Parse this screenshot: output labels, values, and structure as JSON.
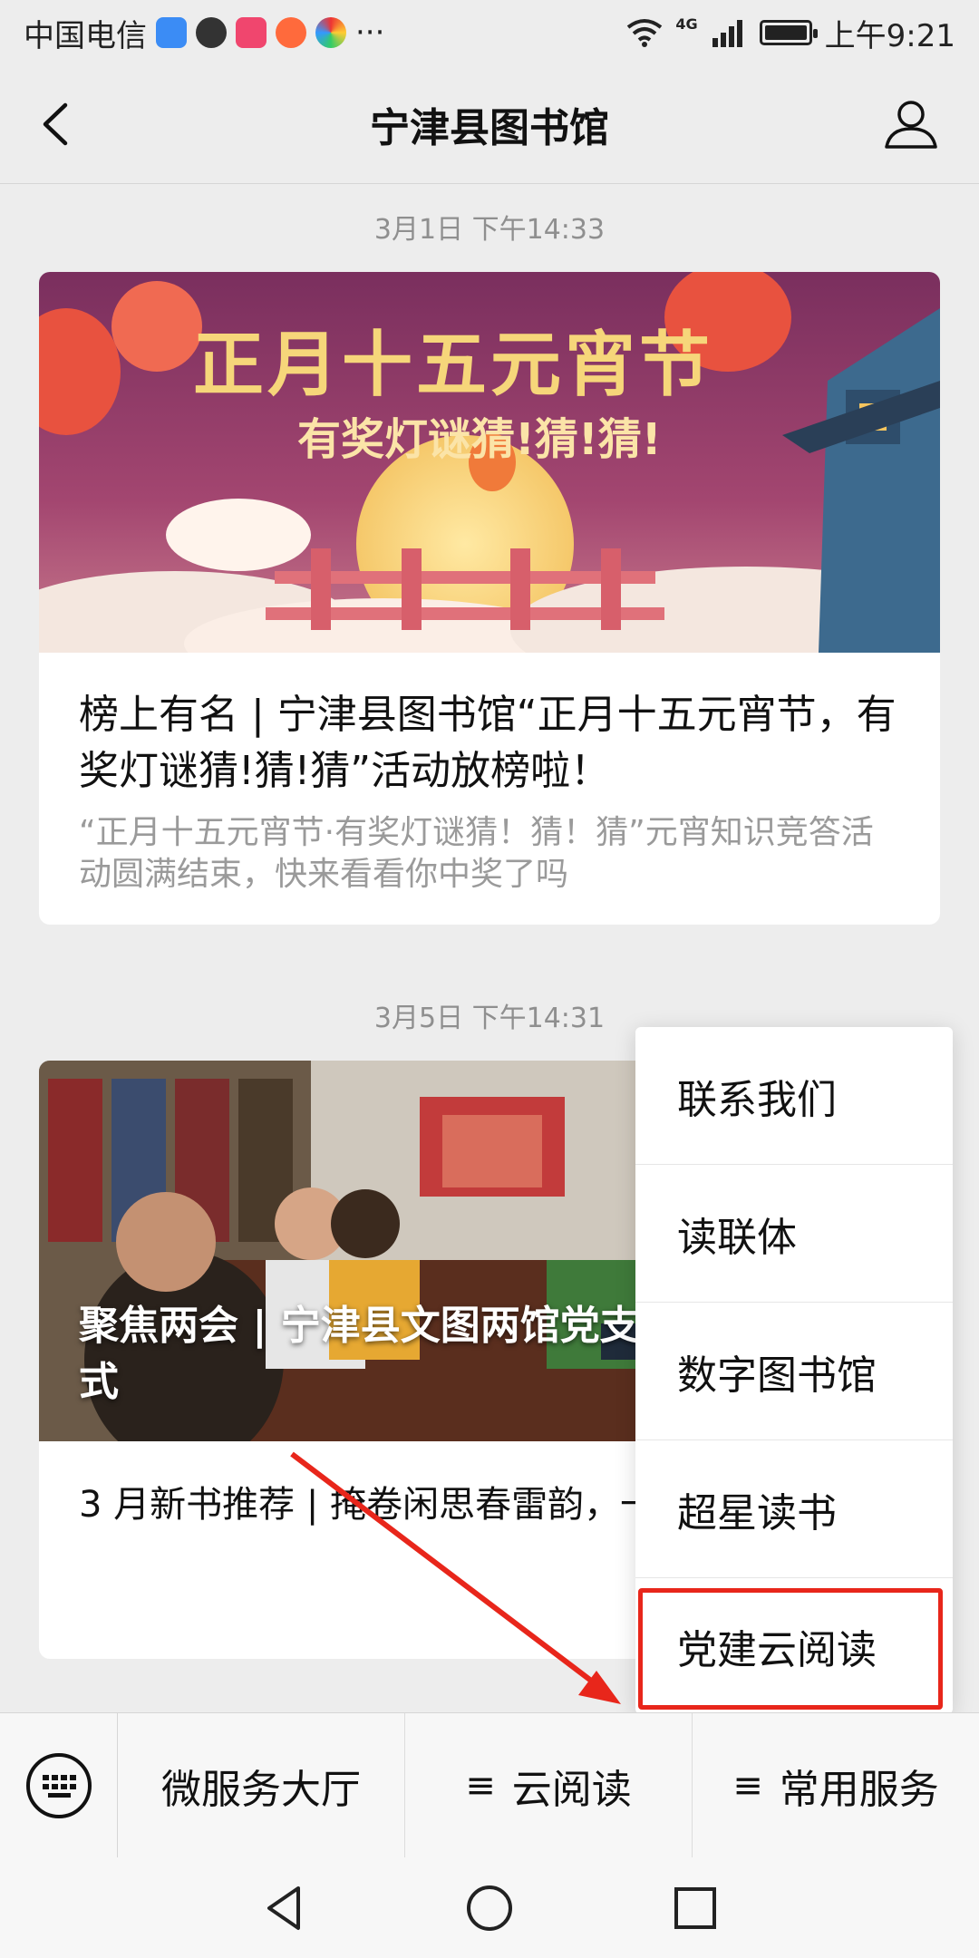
{
  "status_bar": {
    "carrier": "中国电信",
    "more": "···",
    "network": "4G",
    "time": "上午9:21"
  },
  "nav": {
    "title": "宁津县图书馆"
  },
  "messages": [
    {
      "timestamp": "3月1日 下午14:33",
      "banner": {
        "headline": "正月十五元宵节",
        "subline": "有奖灯谜猜!猜!猜!"
      },
      "title": "榜上有名 | 宁津县图书馆“正月十五元宵节，有奖灯谜猜!猜!猜”活动放榜啦！",
      "desc": "“正月十五元宵节·有奖灯谜猜！猜！猜”元宵知识竞答活动圆满结束，快来看看你中奖了吗"
    },
    {
      "timestamp": "3月5日 下午14:31",
      "caption": "聚焦两会 | 宁津县文图两馆党支部收看两会开幕式",
      "sub_title": "3 月新书推荐 | 掩卷闲思春雷韵，一抹新绿迎惊蛰"
    }
  ],
  "popup_menu": {
    "items": [
      "联系我们",
      "读联体",
      "数字图书馆",
      "超星读书",
      "党建云阅读"
    ]
  },
  "bottom_menu": {
    "tabs": [
      "微服务大厅",
      "云阅读",
      "常用服务"
    ]
  },
  "colors": {
    "highlight": "#e8261b",
    "background": "#ededed"
  }
}
